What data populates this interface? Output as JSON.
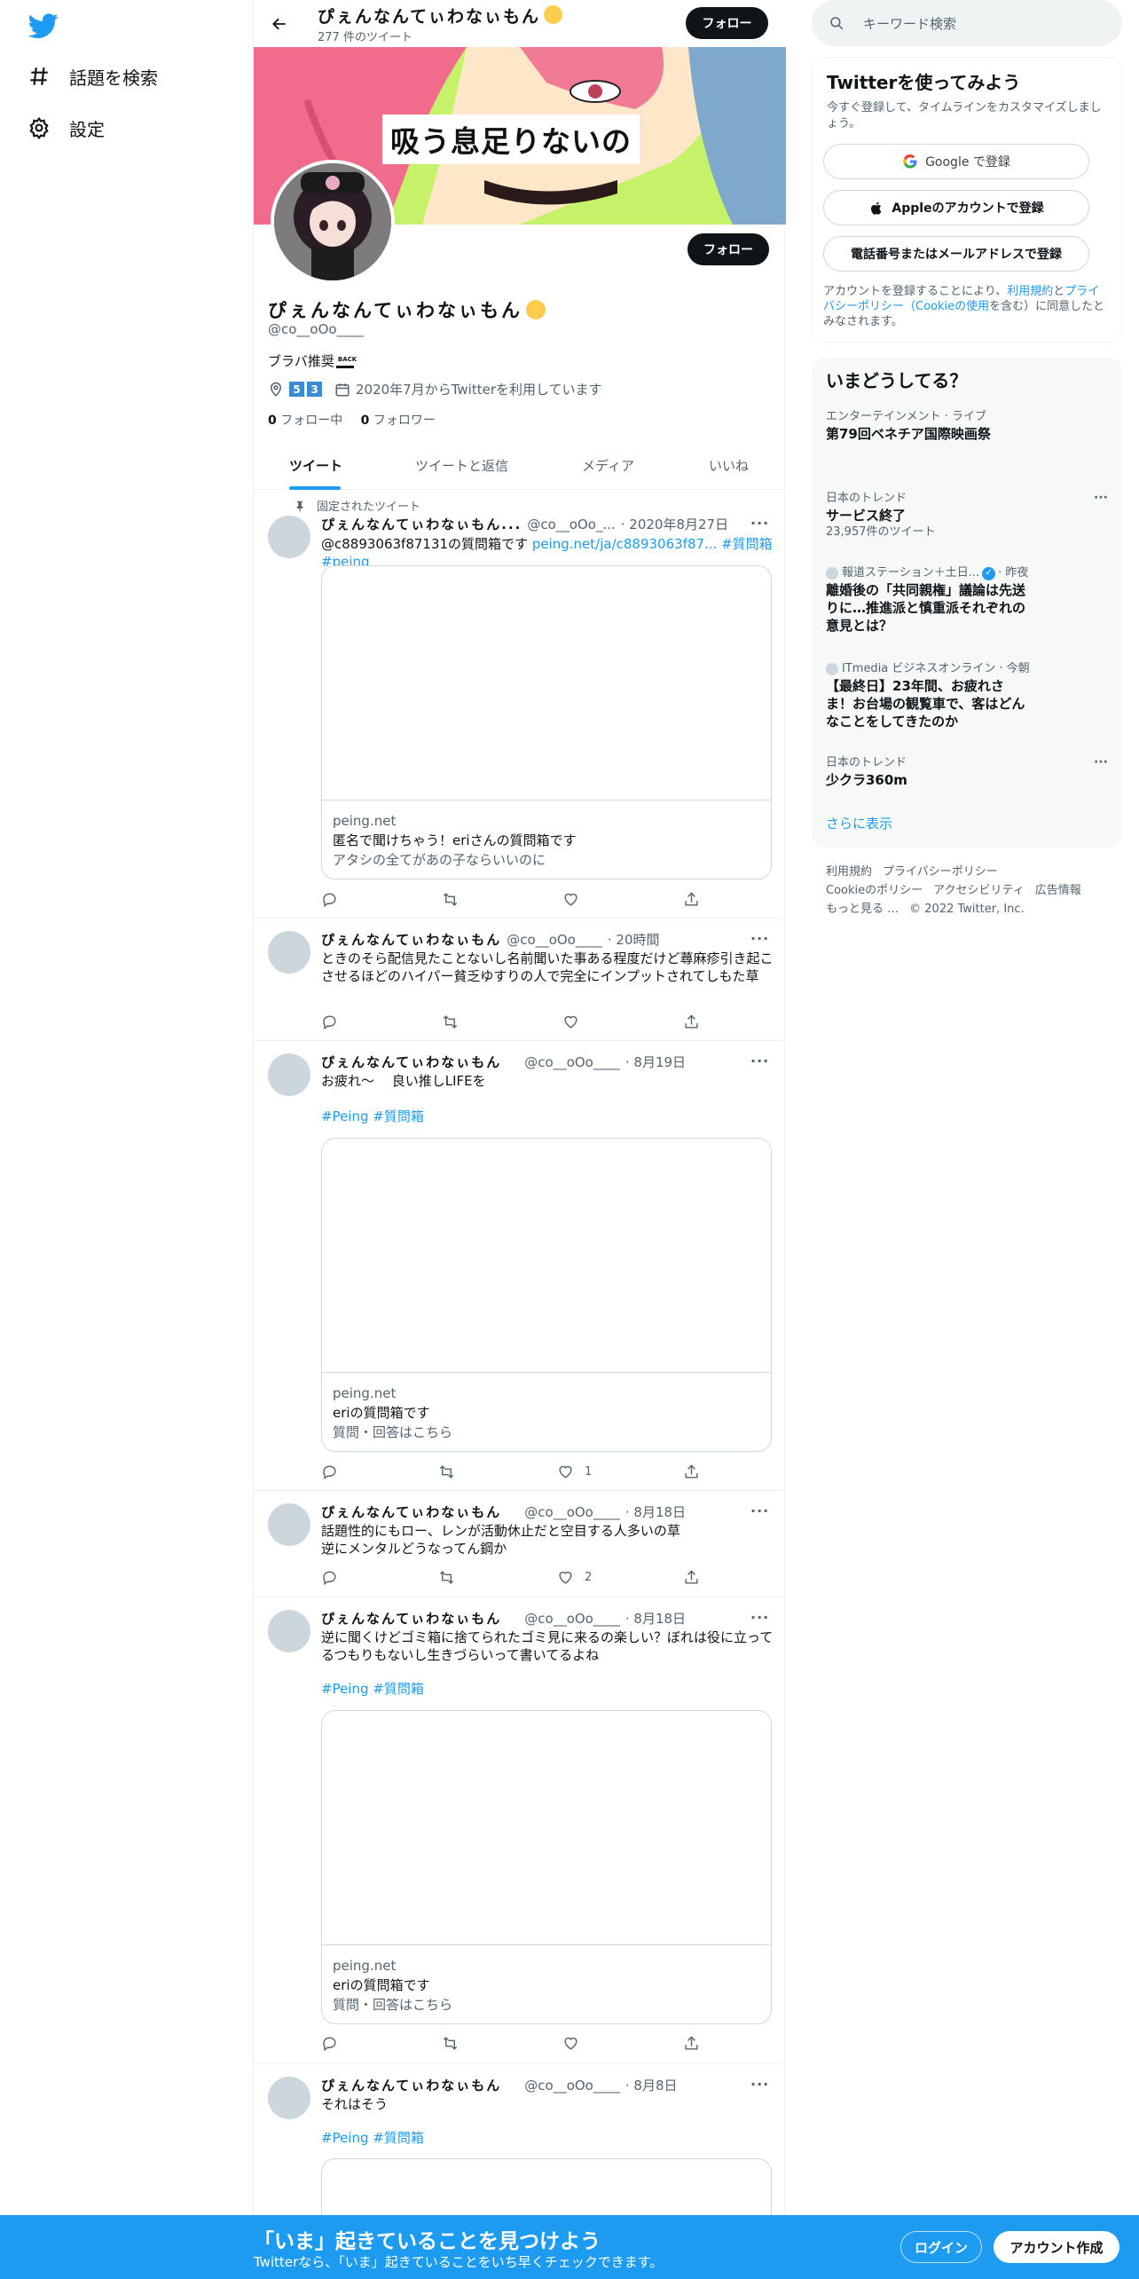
{
  "nav": {
    "items": [
      {
        "label": "話題を検索",
        "icon": "hashtag-icon"
      },
      {
        "label": "設定",
        "icon": "gear-icon"
      }
    ]
  },
  "header": {
    "name": "ぴぇんなんてぃわなぃもん",
    "tweet_count": "277 件のツイート",
    "follow_label": "フォロー"
  },
  "banner": {
    "text": "吸う息足りないの"
  },
  "profile": {
    "name": "ぴぇんなんてぃわなぃもん",
    "handle": "@co__oOo____",
    "bio": "ブラバ推奨",
    "location_badges": [
      "5",
      "3"
    ],
    "joined": "2020年7月からTwitterを利用しています",
    "following_count": "0",
    "following_label": "フォロー中",
    "followers_count": "0",
    "followers_label": "フォロワー",
    "follow_label": "フォロー"
  },
  "tabs": [
    "ツイート",
    "ツイートと返信",
    "メディア",
    "いいね"
  ],
  "pinned_label": "固定されたツイート",
  "tweets": [
    {
      "name": "ぴぇんなんてぃわなぃもん...",
      "handle": "@co__oOo_...",
      "date": "· 2020年8月27日",
      "text_plain": "@c8893063f87131の質問箱です ",
      "text_link": "peing.net/ja/c8893063f87... #質問箱 #peing",
      "card": {
        "domain": "peing.net",
        "title": "匿名で聞けちゃう！eriさんの質問箱です",
        "desc": "アタシの全てがあの子ならいいのに"
      },
      "likes": ""
    },
    {
      "name": "ぴぇんなんてぃわなぃもん",
      "handle": "@co__oOo____",
      "date": "· 20時間",
      "text_plain": "ときのそら配信見たことないし名前聞いた事ある程度だけど蕁麻疹引き起こさせるほどのハイパー貧乏ゆすりの人で完全にインプットされてしもた草",
      "likes": ""
    },
    {
      "name": "ぴぇんなんてぃわなぃもん",
      "handle": "@co__oOo____",
      "date": "· 8月19日",
      "text_plain": "お疲れ〜　 良い推しLIFEを",
      "tags": "#Peing #質問箱",
      "card": {
        "domain": "peing.net",
        "title": "eriの質問箱です",
        "desc": "質問・回答はこちら"
      },
      "likes": "1"
    },
    {
      "name": "ぴぇんなんてぃわなぃもん",
      "handle": "@co__oOo____",
      "date": "· 8月18日",
      "text_plain": "話題性的にもロー、レンが活動休止だと空目する人多いの草\n逆にメンタルどうなってん鋼か",
      "likes": "2"
    },
    {
      "name": "ぴぇんなんてぃわなぃもん",
      "handle": "@co__oOo____",
      "date": "· 8月18日",
      "text_plain": "逆に聞くけどゴミ箱に捨てられたゴミ見に来るの楽しい？ぼれは役に立ってるつもりもないし生きづらいって書いてるよね",
      "tags": "#Peing #質問箱",
      "card": {
        "domain": "peing.net",
        "title": "eriの質問箱です",
        "desc": "質問・回答はこちら"
      },
      "likes": ""
    },
    {
      "name": "ぴぇんなんてぃわなぃもん",
      "handle": "@co__oOo____",
      "date": "· 8月8日",
      "text_plain": "それはそう",
      "tags": "#Peing #質問箱",
      "likes": ""
    }
  ],
  "search": {
    "placeholder": "キーワード検索"
  },
  "signup": {
    "title": "Twitterを使ってみよう",
    "subtitle": "今すぐ登録して、タイムラインをカスタマイズしましょう。",
    "google": "Google で登録",
    "apple": "Appleのアカウントで登録",
    "phone": "電話番号またはメールアドレスで登録",
    "legal_1": "アカウントを登録することにより、",
    "legal_link1": "利用規約",
    "legal_2": "と",
    "legal_link2": "プライバシーポリシー（Cookieの使用",
    "legal_3": "を含む）に同意したとみなされます。"
  },
  "trends": {
    "title": "いまどうしてる？",
    "items": [
      {
        "context": "エンターテインメント · ライブ",
        "name": "第79回ベネチア国際映画祭"
      },
      {
        "context": "日本のトレンド",
        "name": "サービス終了",
        "count": "23,957件のツイート"
      },
      {
        "context": "報道ステーション＋土日...",
        "time": "· 昨夜",
        "name": "離婚後の「共同親権」議論は先送りに…推進派と慎重派それぞれの意見とは？"
      },
      {
        "context": "ITmedia ビジネスオンライン",
        "time": "· 今朝",
        "name": "【最終日】23年間、お疲れさま！お台場の観覧車で、客はどんなことをしてきたのか"
      },
      {
        "context": "日本のトレンド",
        "name": "少クラ360m"
      }
    ],
    "show_more": "さらに表示"
  },
  "footer": {
    "links": [
      "利用規約",
      "プライバシーポリシー",
      "Cookieのポリシー",
      "アクセシビリティ",
      "広告情報",
      "もっと見る …",
      "© 2022 Twitter, Inc."
    ]
  },
  "bottombar": {
    "title": "「いま」起きていることを見つけよう",
    "subtitle": "Twitterなら、「いま」起きていることをいち早くチェックできます。",
    "login": "ログイン",
    "signup": "アカウント作成"
  },
  "colors": {
    "accent": "#1d9bf0",
    "text": "#0f1419",
    "muted": "#536471"
  }
}
